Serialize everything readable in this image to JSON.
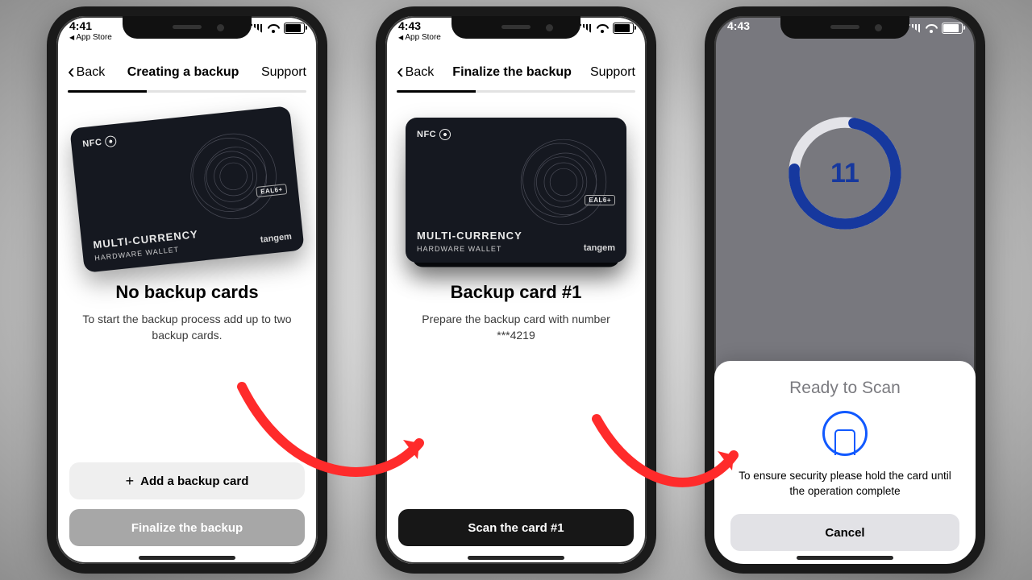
{
  "accent_red": "#ff2b2b",
  "ring_blue": "#16389e",
  "card_brand": "tangem",
  "card_nfc": "NFC",
  "card_title": "MULTI-CURRENCY",
  "card_sub": "HARDWARE WALLET",
  "card_eal": "EAL6+",
  "phones": [
    {
      "time": "4:41",
      "return_to": "App Store",
      "back": "Back",
      "title": "Creating a backup",
      "support": "Support",
      "progress_pct": 33,
      "heading": "No backup cards",
      "desc": "To start the backup process add up to two backup cards.",
      "primary_btn": "Add a backup card",
      "secondary_btn": "Finalize the backup"
    },
    {
      "time": "4:43",
      "return_to": "App Store",
      "back": "Back",
      "title": "Finalize the backup",
      "support": "Support",
      "progress_pct": 33,
      "heading": "Backup card #1",
      "desc": "Prepare the backup card with number ***4219",
      "primary_btn": "Scan the card #1"
    },
    {
      "time": "4:43",
      "countdown": "11",
      "sheet_title": "Ready to Scan",
      "sheet_desc": "To ensure security please hold the card until the operation complete",
      "sheet_cancel": "Cancel"
    }
  ]
}
